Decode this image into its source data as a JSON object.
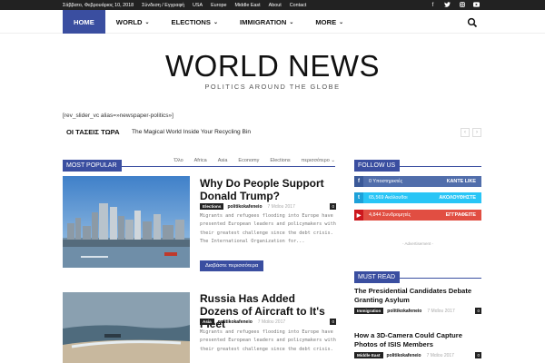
{
  "topbar": {
    "date": "Σάββατο, Φεβρουάριος 10, 2018",
    "links": [
      "Σύνδεση / Εγγραφή",
      "USA",
      "Europe",
      "Middle East",
      "About",
      "Contact"
    ],
    "social_icons": [
      "facebook-icon",
      "twitter-icon",
      "instagram-icon",
      "youtube-icon"
    ]
  },
  "nav": {
    "items": [
      {
        "label": "HOME",
        "active": true
      },
      {
        "label": "WORLD",
        "dropdown": true
      },
      {
        "label": "ELECTIONS",
        "dropdown": true
      },
      {
        "label": "IMMIGRATION",
        "dropdown": true
      },
      {
        "label": "MORE",
        "dropdown": true
      }
    ],
    "chevron": "⌄"
  },
  "logo": {
    "title": "WORLD NEWS",
    "subtitle": "POLITICS AROUND THE GLOBE"
  },
  "shortcode": "[rev_slider_vc alias=»newspaper-politics»]",
  "ticker": {
    "label": "ΟΙ ΤΑΣΕΙΣ ΤΩΡΑ",
    "text": "The Magical World Inside Your Recycling Bin",
    "prev": "‹",
    "next": "›"
  },
  "most_popular": {
    "label": "MOST POPULAR",
    "tabs": [
      "Όλο",
      "Africa",
      "Asia",
      "Economy",
      "Elections",
      "περισσότερο ⌄"
    ]
  },
  "articles": [
    {
      "title": "Why Do People Support Donald Trump?",
      "category": "Elections",
      "author": "politikokafeneio",
      "date": "7 Μαΐου 2017",
      "comments": "0",
      "excerpt": "Migrants and refugees flooding into Europe have presented European leaders and policymakers with their greatest challenge since the debt crisis. The International Organization for...",
      "read_more": "Διαβάστε περισσότερα"
    },
    {
      "title": "Russia Has Added Dozens of Aircraft to It's Fleet",
      "category": "Asia",
      "author": "politikokafeneio",
      "date": "7 Μαΐου 2017",
      "comments": "0",
      "excerpt": "Migrants and refugees flooding into Europe have presented European leaders and policymakers with their greatest challenge since the debt crisis."
    }
  ],
  "follow_us": {
    "label": "FOLLOW US",
    "rows": [
      {
        "icon": "facebook-icon",
        "glyph": "f",
        "count": "0 Υποστηρικτές",
        "action": "ΚΑΝΤΕ LIKE",
        "color": "#516eab",
        "icon_color": "#3b5998"
      },
      {
        "icon": "twitter-icon",
        "glyph": "t",
        "count": "65,569 Ακόλουθοι",
        "action": "ΑΚΟΛΟΥΘΗΣΤΕ",
        "color": "#29c5f6",
        "icon_color": "#1da1d9"
      },
      {
        "icon": "youtube-icon",
        "glyph": "▶",
        "count": "4,844 Συνδρομητές",
        "action": "ΕΓΓΡΑΦΕΙΤΕ",
        "color": "#e14e42",
        "icon_color": "#cc181e"
      }
    ]
  },
  "advertisement": "- Advertisement -",
  "must_read": {
    "label": "MUST READ",
    "items": [
      {
        "title": "The Presidential Candidates Debate Granting Asylum",
        "category": "Immigration",
        "author": "politikokafeneio",
        "date": "7 Μαΐου 2017",
        "comments": "0"
      },
      {
        "title": "How a 3D-Camera Could Capture Photos of ISIS Members",
        "category": "Middle East",
        "author": "politikokafeneio",
        "date": "7 Μαΐου 2017",
        "comments": "0"
      }
    ]
  },
  "colors": {
    "accent": "#3a4ea0",
    "topbar": "#222222"
  }
}
